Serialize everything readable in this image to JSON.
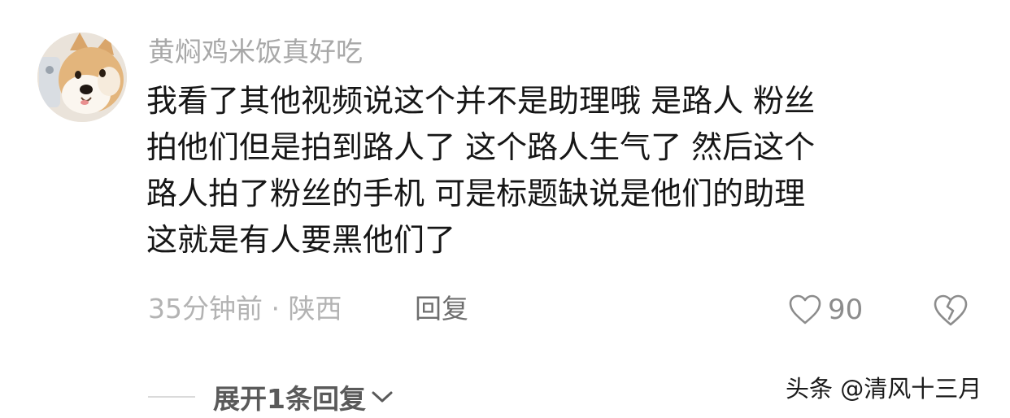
{
  "comment": {
    "username": "黄焖鸡米饭真好吃",
    "lines": [
      "我看了其他视频说这个并不是助理哦 是路人 粉丝",
      "拍他们但是拍到路人了 这个路人生气了 然后这个",
      "路人拍了粉丝的手机 可是标题缺说是他们的助理",
      "这就是有人要黑他们了"
    ],
    "meta": "35分钟前 · 陕西",
    "reply_label": "回复",
    "like_count": "90",
    "expand_label": "展开1条回复"
  },
  "watermark": "头条 @清风十三月",
  "icons": {
    "avatar": "shiba-dog-avatar",
    "like": "heart-outline-icon",
    "dislike": "broken-heart-icon",
    "expand": "chevron-down-icon"
  },
  "colors": {
    "username": "#a8a8a8",
    "comment_text": "#161616",
    "meta": "#b3b3b3",
    "reply": "#6e6e6e",
    "icon": "#8c8c8c"
  }
}
